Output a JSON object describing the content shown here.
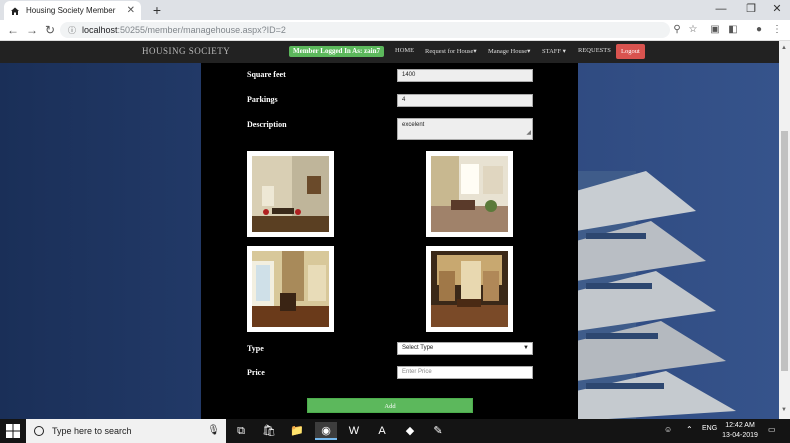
{
  "browser": {
    "tab_title": "Housing Society Member",
    "new_tab_symbol": "+",
    "url_host": "localhost",
    "url_rest": ":50255/member/managehouse.aspx?ID=2",
    "window_controls": [
      "—",
      "❐",
      "✕"
    ]
  },
  "navbar": {
    "brand": "HOUSING SOCIETY",
    "logged_in": "Member Logged In As: zain7",
    "items": [
      "HOME",
      "Request for House▾",
      "Manage House▾",
      "STAFF ▾",
      "REQUESTS"
    ],
    "logout": "Logout"
  },
  "form": {
    "square_feet_label": "Square feet",
    "square_feet_value": "1400",
    "parkings_label": "Parkings",
    "parkings_value": "4",
    "description_label": "Description",
    "description_value": "excelent",
    "type_label": "Type",
    "type_selected": "Select Type",
    "price_label": "Price",
    "price_placeholder": "Enter Price",
    "add_button": "Add"
  },
  "taskbar": {
    "search_placeholder": "Type here to search",
    "language": "ENG",
    "time": "12:42 AM",
    "date": "13-04-2019"
  },
  "colors": {
    "nav_bg": "#222222",
    "success_green": "#5cb85c",
    "danger_red": "#d9534f",
    "panel_bg": "#000000"
  }
}
